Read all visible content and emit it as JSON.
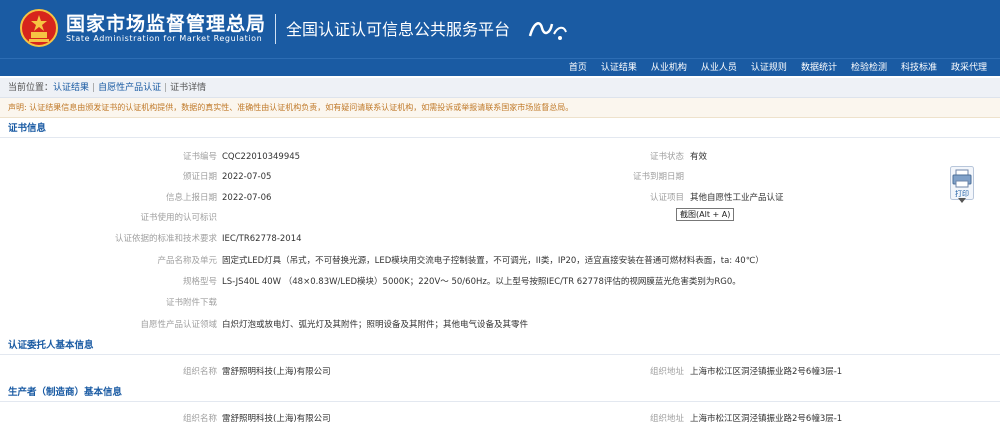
{
  "header": {
    "brand_cn": "国家市场监督管理总局",
    "brand_en": "State Administration for Market Regulation",
    "platform_title": "全国认证认可信息公共服务平台",
    "colors": {
      "bar": "#1a5ba3",
      "emblem_red": "#d7251c",
      "emblem_gold": "#f6c443"
    }
  },
  "nav": {
    "items": [
      "首页",
      "认证结果",
      "从业机构",
      "从业人员",
      "认证规则",
      "数据统计",
      "检验检测",
      "科技标准",
      "政采代理"
    ]
  },
  "breadcrumb": {
    "prefix": "当前位置：",
    "items": [
      "认证结果",
      "自愿性产品认证",
      "证书详情"
    ]
  },
  "notice": "声明: 认证结果信息由颁发证书的认证机构提供，数据的真实性、准确性由认证机构负责，如有疑问请联系认证机构，如需投诉或举报请联系国家市场监督总局。",
  "sections": {
    "cert_info": {
      "title": "证书信息",
      "cert_no_label": "证书编号",
      "cert_no": "CQC22010349945",
      "status_label": "证书状态",
      "status": "有效",
      "issue_date_label": "颁证日期",
      "issue_date": "2022-07-05",
      "expiry_label": "证书到期日期",
      "expiry": "",
      "report_date_label": "信息上报日期",
      "report_date": "2022-07-06",
      "project_label": "认证项目",
      "project": "其他自愿性工业产品认证",
      "mark_label": "证书使用的认可标识",
      "mark": "",
      "standard_label": "认证依据的标准和技术要求",
      "standard": "IEC/TR62778-2014",
      "product_label": "产品名称及单元",
      "product": "固定式LED灯具（吊式，不可替换光源，LED模块用交流电子控制装置，不可调光，II类，IP20，适宜直接安装在普通可燃材料表面，ta: 40℃）",
      "spec_label": "规格型号",
      "spec": "LS-JS40L 40W （48×0.83W/LED模块）5000K；220V～ 50/60Hz。以上型号按照IEC/TR 62778评估的视网膜蓝光危害类别为RG0。",
      "attachment_label": "证书附件下载",
      "attachment": "",
      "domain_label": "自愿性产品认证领域",
      "domain": "白炽灯泡或放电灯、弧光灯及其附件；照明设备及其附件；其他电气设备及其零件"
    },
    "client": {
      "title": "认证委托人基本信息",
      "org_label": "组织名称",
      "org": "雷舒照明科技(上海)有限公司",
      "addr_label": "组织地址",
      "addr": "上海市松江区洞泾镇振业路2号6幢3层-1"
    },
    "producer": {
      "title": "生产者（制造商）基本信息",
      "org_label": "组织名称",
      "org": "雷舒照明科技(上海)有限公司",
      "addr_label": "组织地址",
      "addr": "上海市松江区洞泾镇振业路2号6幢3层-1"
    }
  },
  "print_button": {
    "label": "打印",
    "icon": "printer-icon"
  },
  "tooltip": "截图(Alt + A)"
}
